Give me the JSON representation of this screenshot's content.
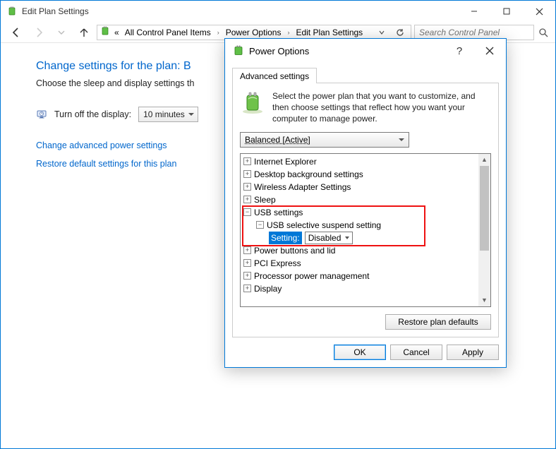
{
  "window": {
    "title": "Edit Plan Settings"
  },
  "breadcrumbs": {
    "dbl_chevron": "«",
    "c1": "All Control Panel Items",
    "c2": "Power Options",
    "c3": "Edit Plan Settings"
  },
  "search": {
    "placeholder": "Search Control Panel"
  },
  "page": {
    "heading_prefix": "Change settings for the plan: ",
    "heading_plan": "B",
    "subtext": "Choose the sleep and display settings th",
    "turnoff_label": "Turn off the display:",
    "turnoff_value": "10 minutes",
    "link_adv": "Change advanced power settings",
    "link_restore": "Restore default settings for this plan"
  },
  "dialog": {
    "title": "Power Options",
    "tab": "Advanced settings",
    "desc": "Select the power plan that you want to customize, and then choose settings that reflect how you want your computer to manage power.",
    "plan": "Balanced [Active]",
    "tree": [
      "Internet Explorer",
      "Desktop background settings",
      "Wireless Adapter Settings",
      "Sleep",
      "USB settings",
      "USB selective suspend setting",
      "Setting:",
      "Disabled",
      "Power buttons and lid",
      "PCI Express",
      "Processor power management",
      "Display"
    ],
    "restore": "Restore plan defaults",
    "ok": "OK",
    "cancel": "Cancel",
    "apply": "Apply"
  }
}
